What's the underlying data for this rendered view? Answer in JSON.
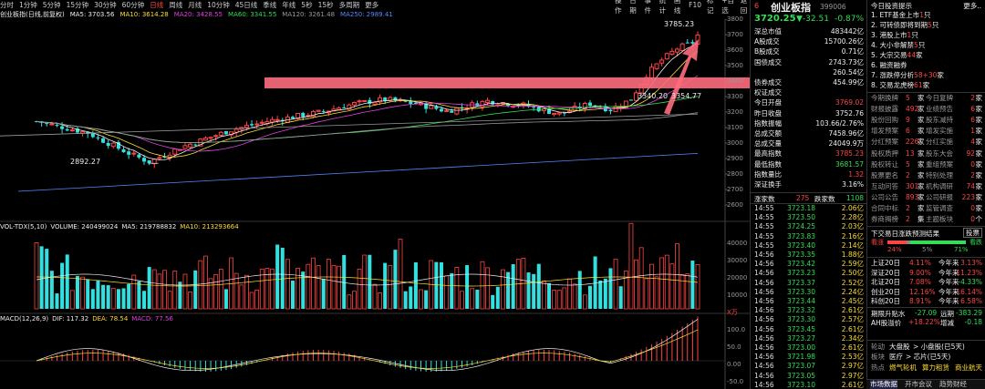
{
  "periods": [
    "分时",
    "1分钟",
    "5分钟",
    "15分钟",
    "30分钟",
    "60分钟",
    "日线",
    "周线",
    "月线",
    "10分钟",
    "45日线",
    "季线",
    "年线",
    "5秒",
    "15秒",
    "多周期",
    "更多"
  ],
  "active_period": "日线",
  "toolbar": [
    "操作",
    "日期",
    "事件",
    "统计",
    "画线",
    "F10",
    "标记",
    "+自选",
    "返回"
  ],
  "kline_info": {
    "name": "创业板指(日线,前复权)",
    "ma5": "MA5: 3703.56",
    "ma10": "MA10: 3614.28",
    "ma20": "MA20: 3428.55",
    "ma60": "MA60: 3341.55",
    "ma120": "MA120: 3261.48",
    "ma250": "MA250: 2989.41"
  },
  "kline_labels": {
    "high": "3785.23",
    "low": "2892.27",
    "mid1": "3340.20",
    "mid2": "3354.77"
  },
  "price_axis": [
    "3800",
    "3700",
    "3600",
    "3500",
    "3400",
    "3300",
    "3200",
    "3100",
    "3000",
    "2900",
    "2800",
    "2700",
    "2600"
  ],
  "vol_info": {
    "name": "VOL-TDX(5,10)",
    "volume": "VOLUME: 240499024",
    "ma5": "MA5: 219788832",
    "ma10": "MA10: 213293664"
  },
  "vol_axis": [
    "40000",
    "30000",
    "20000",
    "10000",
    "X万"
  ],
  "macd_info": {
    "name": "MACD(12,26,9)",
    "dif": "DIF: 117.32",
    "dea": "DEA: 78.54",
    "macd": "MACD: 77.56"
  },
  "macd_axis": [
    "100.0",
    "50.0",
    "0.00",
    "-50.0"
  ],
  "quote": {
    "index_num": "6",
    "name": "创业板指",
    "code": "399006",
    "price": "3720.25",
    "change": "▼-32.51",
    "pct": "-0.87%",
    "rows": [
      {
        "l": "深总市值",
        "r": "483442亿",
        "c": "wht"
      },
      {
        "l": "A股成交",
        "r": "15700.26亿",
        "c": "wht"
      },
      {
        "l": "B股成交",
        "r": "0.71亿",
        "c": "wht"
      },
      {
        "l": "国债成交",
        "r": "2743.73亿",
        "c": "wht"
      },
      {
        "l": "",
        "r": "260.54亿",
        "c": "wht"
      },
      {
        "l": "债券成交",
        "r": "454.99亿",
        "c": "wht"
      },
      {
        "l": "权证成交",
        "r": "",
        "c": "wht"
      },
      {
        "l": "今日开盘",
        "r": "3769.02",
        "c": "red"
      },
      {
        "l": "昨日收盘",
        "r": "3752.76",
        "c": "wht"
      },
      {
        "l": "指数振幅",
        "r": "103.66/2.76%",
        "c": "wht"
      },
      {
        "l": "总成交额",
        "r": "7458.96亿",
        "c": "wht"
      },
      {
        "l": "总成交量",
        "r": "24049.9万",
        "c": "wht"
      },
      {
        "l": "最高指数",
        "r": "3785.23",
        "c": "red"
      },
      {
        "l": "最低指数",
        "r": "3681.57",
        "c": "grn"
      },
      {
        "l": "指数量比",
        "r": "1.32",
        "c": "red"
      },
      {
        "l": "深证换手",
        "r": "3.16%",
        "c": "wht"
      }
    ],
    "updown": {
      "up_label": "涨家数",
      "up": "275",
      "down_label": "跌家数",
      "down": "1108"
    },
    "ticks": [
      [
        "14:55",
        "3723.18",
        "2.06亿"
      ],
      [
        "14:55",
        "3723.50",
        "2.28亿"
      ],
      [
        "14:55",
        "3724.25",
        "2.03亿"
      ],
      [
        "14:55",
        "3723.83",
        "2.16亿"
      ],
      [
        "14:55",
        "3723.40",
        "2.14亿"
      ],
      [
        "14:56",
        "3723.35",
        "1.88亿"
      ],
      [
        "14:56",
        "3723.42",
        "2.59亿"
      ],
      [
        "14:56",
        "3723.23",
        "2.50亿"
      ],
      [
        "14:56",
        "3723.37",
        "2.52亿"
      ],
      [
        "14:56",
        "3723.30",
        "2.24亿"
      ],
      [
        "14:56",
        "3723.44",
        "2.45亿"
      ],
      [
        "14:56",
        "3723.32",
        "2.61亿"
      ],
      [
        "14:56",
        "3723.30",
        "2.57亿"
      ],
      [
        "14:56",
        "3723.45",
        "2.61亿"
      ],
      [
        "14:56",
        "3723.27",
        "2.34亿"
      ],
      [
        "14:56",
        "3723.00",
        "2.61亿"
      ],
      [
        "14:56",
        "3721.98",
        "2.53亿"
      ],
      [
        "14:56",
        "3723.07",
        "2.97亿"
      ],
      [
        "14:56",
        "3723.05",
        "2.97亿"
      ],
      [
        "14:56",
        "3723.10",
        "2.61亿"
      ]
    ]
  },
  "news": {
    "title": "今日投资提示",
    "more": "更多..",
    "items": [
      {
        "pre": "1. ETF基金上市",
        "num": "1",
        "post": "只"
      },
      {
        "pre": "2. 可转债即将到期",
        "num": "5",
        "post": "只"
      },
      {
        "pre": "3. 港股上市",
        "num": "1",
        "post": "只"
      },
      {
        "pre": "4. 大小非解禁",
        "num": "5",
        "post": "只"
      },
      {
        "pre": "5. 大宗交易",
        "num": "44",
        "post": "家"
      },
      {
        "pre": "6. 融资融券",
        "num": "",
        "post": ""
      },
      {
        "pre": "7. 涨跌停分析",
        "num": "58+30",
        "post": "家"
      },
      {
        "pre": "8. 交易龙虎榜",
        "num": "61",
        "post": "家"
      }
    ],
    "stats": [
      [
        "今期换牌",
        "5",
        "家",
        "今日复牌",
        "2",
        "家"
      ],
      [
        "财报披露",
        "492",
        "家",
        "业绩预告",
        "6",
        "家"
      ],
      [
        "股份回购",
        "9",
        "家",
        "股东减持",
        "6",
        "家"
      ],
      [
        "增发预案",
        "6",
        "家",
        "增发实施",
        "1",
        "家"
      ],
      [
        "分红预案",
        "226",
        "家",
        "分红实施",
        "4",
        "家"
      ],
      [
        "股权质押",
        "13",
        "家",
        "股东大会",
        "92",
        "家"
      ],
      [
        "股权转让",
        "5",
        "家",
        "重组预案",
        "0",
        "家"
      ],
      [
        "股票更名",
        "2",
        "家",
        "特别处理",
        "2",
        "家"
      ],
      [
        "互动问答",
        "301",
        "家",
        "机构调研",
        "74",
        "家"
      ],
      [
        "公司公告",
        "893",
        "家",
        "公司研报",
        "223",
        "家"
      ],
      [
        "合同中标",
        "2",
        "家",
        "监管调查",
        "0",
        "家"
      ],
      [
        "券商揭榜",
        "2",
        "集",
        "主题板块",
        "0",
        "个"
      ]
    ],
    "next_label": "下交易日涨跌预测结果",
    "next_btn": "投票",
    "bar": {
      "left": "看涨",
      "right": "看跌",
      "a": "24%",
      "b": "5%",
      "c": "71%"
    },
    "periods": [
      {
        "l": "上证20日",
        "v1": "4.11%",
        "m": "今年来",
        "v2": "3.13%"
      },
      {
        "l": "深证20日",
        "v1": "9.00%",
        "m": "今年来",
        "v2": "11.23%"
      },
      {
        "l": "北证20日",
        "v1": "7.08%",
        "m": "今年来",
        "v2": "-4.33%"
      },
      {
        "l": "创业20日",
        "v1": "12.16%",
        "m": "今年来",
        "v2": "16.14%"
      },
      {
        "l": "科创20日",
        "v1": "8.91%",
        "m": "今年来",
        "v2": "6.58%"
      }
    ],
    "extra1": {
      "l": "期限升贴水",
      "v1": "-27.09",
      "m": "远期",
      "v2": "-383.29"
    },
    "extra2": {
      "l": "AH股溢价",
      "v1": "+18.22%",
      "m": "增减",
      "v2": "-0.18"
    },
    "rot1": {
      "l": "轮动",
      "a": "大盘股",
      "b": "> 小盘股(已5天)"
    },
    "rot2": {
      "l": "板块",
      "a": "医疗",
      "b": "> 芯片(已5天)"
    },
    "hot": {
      "l": "热点",
      "a": "燃气轮机",
      "b": "算力租赁",
      "c": "商业航天"
    }
  },
  "bottom_tabs": [
    "市场数据",
    "开市会议",
    "趋势财经"
  ],
  "colors": {
    "up": "#ff4444",
    "down": "#33e0e0",
    "ma5": "#eeeeee",
    "ma10": "#ffdd33",
    "ma20": "#e040e0",
    "ma60": "#33dd55",
    "ma120": "#999999",
    "ma250": "#5588ff"
  }
}
